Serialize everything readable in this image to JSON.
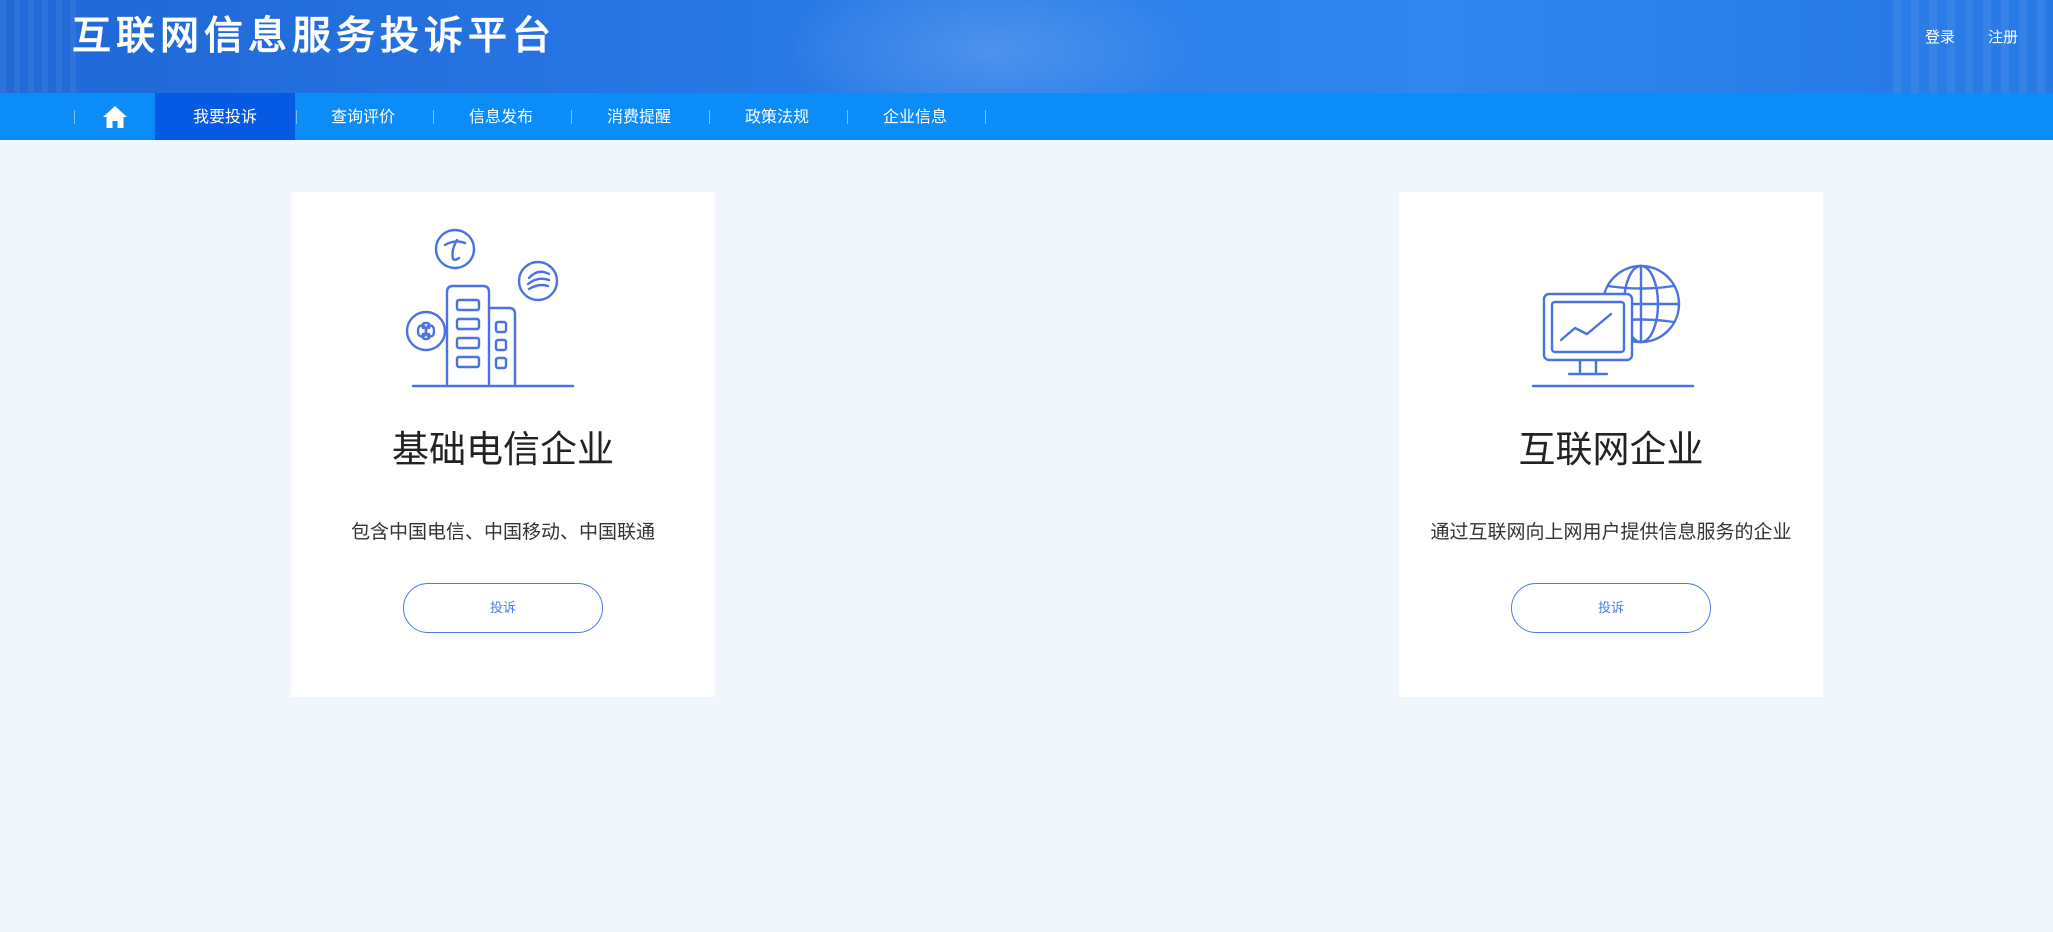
{
  "header": {
    "title": "互联网信息服务投诉平台",
    "login_label": "登录",
    "register_label": "注册"
  },
  "nav": {
    "home_icon": "home-icon",
    "items": [
      {
        "label": "我要投诉",
        "active": true
      },
      {
        "label": "查询评价",
        "active": false
      },
      {
        "label": "信息发布",
        "active": false
      },
      {
        "label": "消费提醒",
        "active": false
      },
      {
        "label": "政策法规",
        "active": false
      },
      {
        "label": "企业信息",
        "active": false
      }
    ]
  },
  "cards": [
    {
      "icon": "telecom-buildings-icon",
      "title": "基础电信企业",
      "description": "包含中国电信、中国移动、中国联通",
      "button_label": "投诉"
    },
    {
      "icon": "monitor-globe-icon",
      "title": "互联网企业",
      "description": "通过互联网向上网用户提供信息服务的企业",
      "button_label": "投诉"
    }
  ],
  "colors": {
    "header_bg": "#2a7ce8",
    "nav_bg": "#0b8cf9",
    "nav_active": "#0659e3",
    "page_bg": "#f1f5fc",
    "accent": "#4b7be5"
  }
}
